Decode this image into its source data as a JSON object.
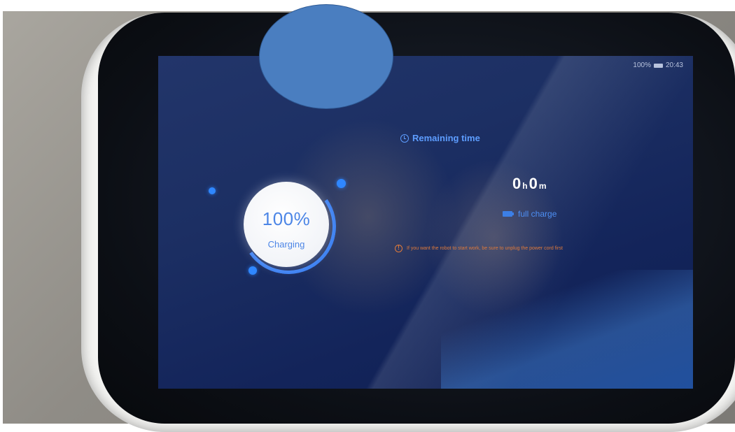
{
  "status_bar": {
    "battery": "100%",
    "time": "20:43"
  },
  "charge": {
    "percent_label": "100%",
    "state": "Charging",
    "level": 1.0
  },
  "remaining": {
    "label": "Remaining time",
    "hours": "0",
    "hours_unit": "h",
    "minutes": "0",
    "minutes_unit": "m"
  },
  "battery_status": "full charge",
  "warning": "If you want the robot to start work, be sure to unplug the power cord first",
  "colors": {
    "accent": "#4d86e6",
    "warning": "#e07a3a",
    "screen_bg": "#1c2f63"
  },
  "icons": {
    "clock": "clock-icon",
    "battery": "battery-icon",
    "warning": "warning-icon"
  }
}
